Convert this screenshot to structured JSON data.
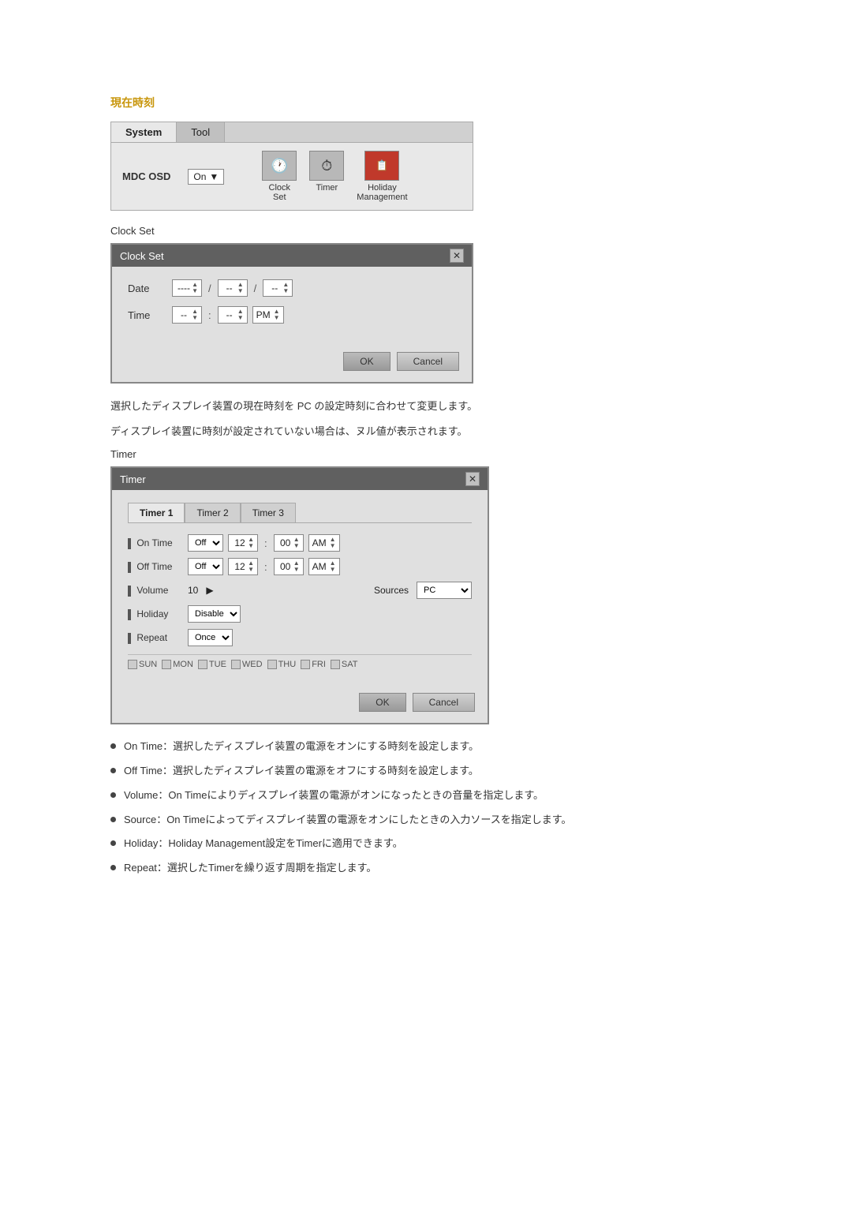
{
  "page": {
    "section_title": "現在時刻",
    "mdc_panel": {
      "tabs": [
        "System",
        "Tool"
      ],
      "active_tab": "System",
      "osd_label": "MDC OSD",
      "osd_value": "On",
      "icons": [
        {
          "label": "Clock\nSet",
          "symbol": "🕐"
        },
        {
          "label": "Timer",
          "symbol": "⏱"
        },
        {
          "label": "Holiday\nManagement",
          "symbol": "📋"
        }
      ]
    },
    "clock_set_label": "Clock Set",
    "clock_set_dialog": {
      "title": "Clock Set",
      "date_label": "Date",
      "date_val1": "----",
      "date_sep1": "/",
      "date_val2": "--",
      "date_sep2": "/",
      "date_val3": "--",
      "time_label": "Time",
      "time_val1": "--",
      "time_sep": ":",
      "time_val2": "--",
      "time_ampm": "PM",
      "ok_label": "OK",
      "cancel_label": "Cancel"
    },
    "desc1": "選択したディスプレイ装置の現在時刻を PC の設定時刻に合わせて変更します。",
    "desc2": "ディスプレイ装置に時刻が設定されていない場合は、ヌル値が表示されます。",
    "timer_label": "Timer",
    "timer_dialog": {
      "title": "Timer",
      "tabs": [
        "Timer 1",
        "Timer 2",
        "Timer 3"
      ],
      "active_tab": "Timer 1",
      "on_time_label": "On Time",
      "off_time_label": "Off Time",
      "on_time_status": "Off",
      "off_time_status": "Off",
      "on_hour": "12",
      "on_min": "00",
      "on_ampm": "AM",
      "off_hour": "12",
      "off_min": "00",
      "off_ampm": "AM",
      "volume_label": "Volume",
      "volume_val": "10",
      "sources_label": "Sources",
      "sources_val": "PC",
      "holiday_label": "Holiday",
      "holiday_val": "Disable",
      "repeat_label": "Repeat",
      "repeat_val": "Once",
      "days": [
        "SUN",
        "MON",
        "TUE",
        "WED",
        "THU",
        "FRI",
        "SAT"
      ],
      "ok_label": "OK",
      "cancel_label": "Cancel"
    },
    "bullets": [
      {
        "text": "On Time：選択したディスプレイ装置の電源をオンにする時刻を設定します。"
      },
      {
        "text": "Off Time：選択したディスプレイ装置の電源をオフにする時刻を設定します。"
      },
      {
        "text": "Volume：On Timeによりディスプレイ装置の電源がオンになったときの音量を指定します。"
      },
      {
        "text": "Source：On Timeによってディスプレイ装置の電源をオンにしたときの入力ソースを指定します。"
      },
      {
        "text": "Holiday：Holiday Management設定をTimerに適用できます。"
      },
      {
        "text": "Repeat：選択したTimerを繰り返す周期を指定します。"
      }
    ]
  }
}
